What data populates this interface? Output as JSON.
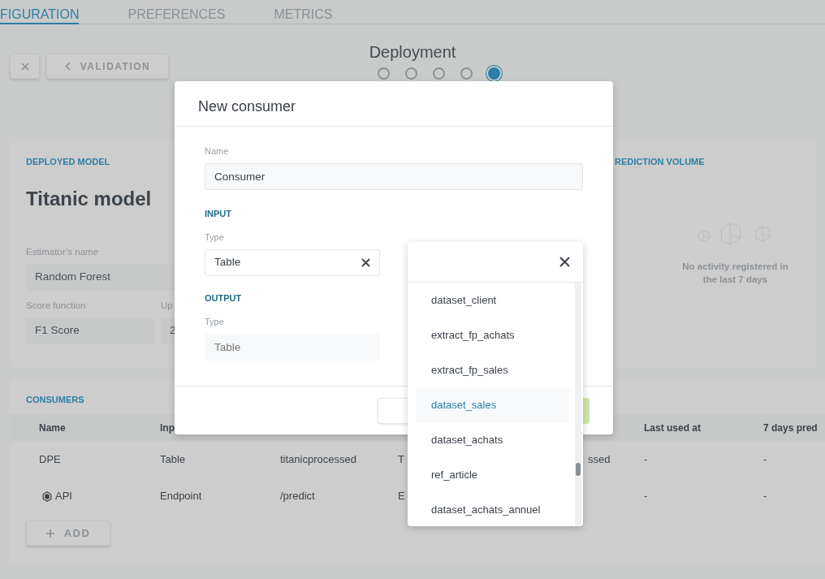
{
  "tabs": [
    {
      "label": "FIGURATION",
      "selected": true
    },
    {
      "label": "PREFERENCES",
      "selected": false
    },
    {
      "label": "METRICS",
      "selected": false
    }
  ],
  "toolbar": {
    "back_button": {
      "label": "VALIDATION"
    },
    "title": "Deployment",
    "steps": [
      {
        "active": false
      },
      {
        "active": false
      },
      {
        "active": false
      },
      {
        "active": false
      },
      {
        "active": true
      }
    ]
  },
  "deployed_model": {
    "heading": "DEPLOYED MODEL",
    "model_name": "Titanic model",
    "fields": [
      {
        "label": "Estimator’s name",
        "value": "Random Forest",
        "kind": "wide"
      },
      {
        "label": "Score function",
        "value": "F1 Score",
        "kind": "half"
      },
      {
        "label": "Up",
        "value": "2",
        "kind": "half"
      }
    ]
  },
  "prediction_volume": {
    "heading": "REDICTION VOLUME",
    "empty_message": "No activity registered in the last 7 days"
  },
  "consumers": {
    "heading": "CONSUMERS",
    "header": {
      "name": "Name",
      "input_type": "Inp",
      "last_used_at": "Last used at",
      "column_7": "7 days pred"
    },
    "rows": [
      {
        "kind": "table",
        "name": "DPE",
        "input_type": "Table",
        "input": "titanicprocessed",
        "column_4": "T",
        "column_5": "ssed",
        "last_used_at": "-",
        "column_7": "-"
      },
      {
        "kind": "endpoint",
        "name": "API",
        "input_type": "Endpoint",
        "input": "/predict",
        "column_4": "E",
        "last_used_at": "-",
        "column_7": "-"
      }
    ],
    "add_button": {
      "label": "ADD"
    }
  },
  "modal": {
    "title": "New consumer",
    "name_field": {
      "label": "Name",
      "value": "Consumer"
    },
    "input": {
      "heading": "INPUT",
      "type_label": "Type",
      "type_value": "Table"
    },
    "output": {
      "heading": "OUTPUT",
      "type_label": "Type",
      "type_placeholder": "Table"
    },
    "footer_buttons": [
      {
        "kind": "secondary"
      },
      {
        "kind": "primary"
      }
    ]
  },
  "dropdown": {
    "items": [
      {
        "label": "dataset_client",
        "selected": false
      },
      {
        "label": "extract_fp_achats",
        "selected": false
      },
      {
        "label": "extract_fp_sales",
        "selected": false
      },
      {
        "label": "dataset_sales",
        "selected": true
      },
      {
        "label": "dataset_achats",
        "selected": false
      },
      {
        "label": "ref_article",
        "selected": false
      },
      {
        "label": "dataset_achats_annuel",
        "selected": false
      }
    ]
  }
}
